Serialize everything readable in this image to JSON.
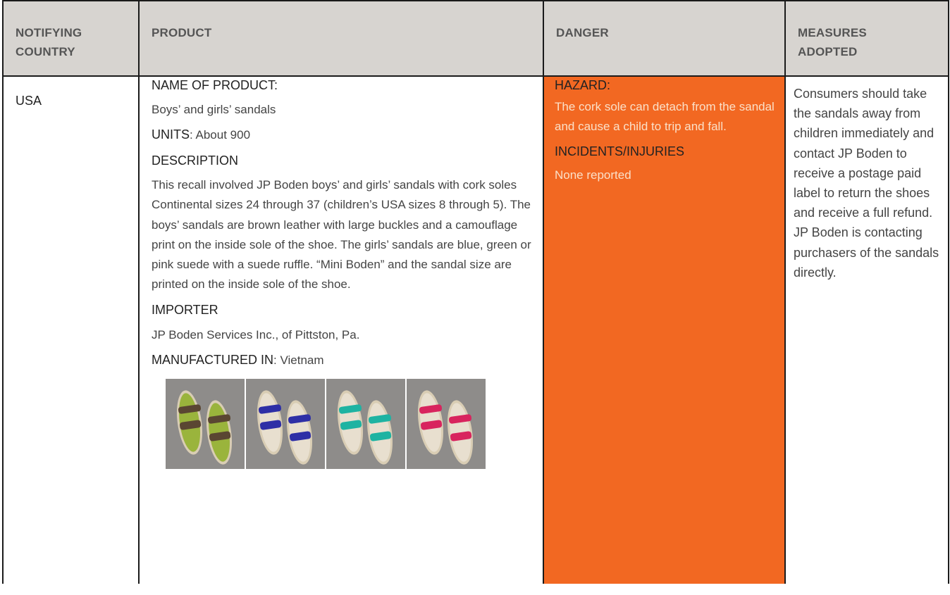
{
  "headers": {
    "country": "NOTIFYING\nCOUNTRY",
    "product": "PRODUCT",
    "danger": "DANGER",
    "measures": "MEASURES\nADOPTED"
  },
  "row": {
    "country": "USA",
    "product": {
      "name_label": "NAME OF PRODUCT:",
      "name_value": "Boys’ and girls’ sandals",
      "units_label": "UNITS",
      "units_value": ": About 900",
      "description_label": "DESCRIPTION",
      "description_text": "This recall involved JP Boden boys’ and girls’ sandals with cork soles Continental sizes 24 through 37 (children’s USA sizes 8 through 5). The boys’ sandals are brown leather with large buckles and a camouflage print on the inside sole of the shoe. The girls’ sandals are blue, green or pink suede with a suede ruffle. “Mini Boden” and the sandal size are printed on the inside sole of the shoe.",
      "importer_label": "IMPORTER",
      "importer_value": "JP Boden Services Inc., of Pittston, Pa.",
      "manufactured_label": "MANUFACTURED IN",
      "manufactured_value": ": Vietnam",
      "photos": [
        {
          "name": "boys-camo-brown-sandals",
          "strap": "#5a4632",
          "insole": "#9ab43c"
        },
        {
          "name": "girls-blue-suede-sandals",
          "strap": "#2e2fa6",
          "insole": "#e8dfcf"
        },
        {
          "name": "girls-green-suede-sandals",
          "strap": "#1eb3a2",
          "insole": "#e8dfcf"
        },
        {
          "name": "girls-pink-suede-sandals",
          "strap": "#d8245e",
          "insole": "#e8dfcf"
        }
      ]
    },
    "danger": {
      "hazard_label": "HAZARD:",
      "hazard_text": "The cork sole can detach from the sandal and cause a child to trip and fall.",
      "incidents_label": "INCIDENTS/INJURIES",
      "incidents_text": "None reported"
    },
    "measures": "Consumers should take the sandals away from children immediately and contact JP Boden to receive a postage paid label to return the shoes and receive a full refund. JP Boden is contacting purchasers of the sandals directly."
  },
  "colors": {
    "header_bg": "#d7d4d0",
    "danger_bg": "#f26822",
    "danger_text": "#fbe0c8"
  }
}
